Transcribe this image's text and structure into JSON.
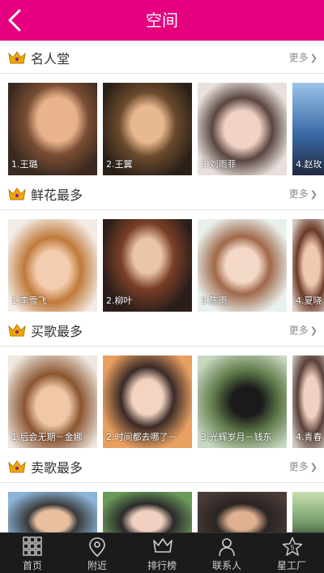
{
  "header": {
    "title": "空间"
  },
  "sections": [
    {
      "title": "名人堂",
      "more": "更多",
      "items": [
        "1.王璐",
        "2.王翼",
        "3.刘雨菲",
        "4.赵玫"
      ]
    },
    {
      "title": "鲜花最多",
      "more": "更多",
      "items": [
        "1.李雪飞",
        "2.柳叶",
        "3.陈雨",
        "4.夏晓"
      ]
    },
    {
      "title": "买歌最多",
      "more": "更多",
      "items": [
        "1.后会无期－金娜",
        "2.时间都去哪了－",
        "3.光辉岁月－钱东",
        "4.青春"
      ]
    },
    {
      "title": "卖歌最多",
      "more": "更多",
      "items": [
        "",
        "",
        "",
        ""
      ]
    }
  ],
  "tabs": [
    {
      "label": "首页",
      "icon": "grid-icon"
    },
    {
      "label": "附近",
      "icon": "location-pin-icon"
    },
    {
      "label": "排行榜",
      "icon": "crown-icon"
    },
    {
      "label": "联系人",
      "icon": "contact-icon"
    },
    {
      "label": "星工厂",
      "icon": "star-factory-icon"
    }
  ],
  "colors": {
    "brand": "#e5007f",
    "tabbar": "#1b1b1b",
    "crown": "#f0a800"
  }
}
